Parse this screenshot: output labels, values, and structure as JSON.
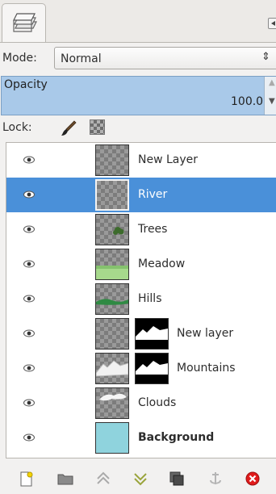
{
  "header": {
    "tab_icon": "layers-icon",
    "menu_icon": "tab-menu-arrow-icon"
  },
  "mode": {
    "label": "Mode:",
    "value": "Normal"
  },
  "opacity": {
    "label": "Opacity",
    "value": "100.0",
    "percent": 100
  },
  "lock": {
    "label": "Lock:",
    "icons": [
      "paintbrush-icon",
      "alpha-checker-icon"
    ]
  },
  "layers": [
    {
      "name": "New Layer",
      "visible": true,
      "selected": false,
      "bold": false,
      "thumb": "transparent",
      "mask": false
    },
    {
      "name": "River",
      "visible": true,
      "selected": true,
      "bold": false,
      "thumb": "transparent",
      "mask": false
    },
    {
      "name": "Trees",
      "visible": true,
      "selected": false,
      "bold": false,
      "thumb": "trees",
      "mask": false
    },
    {
      "name": "Meadow",
      "visible": true,
      "selected": false,
      "bold": false,
      "thumb": "meadow",
      "mask": false
    },
    {
      "name": "Hills",
      "visible": true,
      "selected": false,
      "bold": false,
      "thumb": "hills",
      "mask": false
    },
    {
      "name": "New layer",
      "visible": true,
      "selected": false,
      "bold": false,
      "thumb": "transparent",
      "mask": true
    },
    {
      "name": "Mountains",
      "visible": true,
      "selected": false,
      "bold": false,
      "thumb": "mountains",
      "mask": true
    },
    {
      "name": "Clouds",
      "visible": true,
      "selected": false,
      "bold": false,
      "thumb": "clouds",
      "mask": false
    },
    {
      "name": "Background",
      "visible": true,
      "selected": false,
      "bold": true,
      "thumb": "sky",
      "mask": false
    }
  ],
  "actions": [
    "new-layer-icon",
    "new-layer-group-icon",
    "raise-layer-icon",
    "lower-layer-icon",
    "duplicate-layer-icon",
    "anchor-layer-icon",
    "delete-layer-icon"
  ],
  "colors": {
    "selection": "#4a90d9",
    "opacity_fill": "#a9c9e9",
    "delete": "#e01b1b"
  }
}
